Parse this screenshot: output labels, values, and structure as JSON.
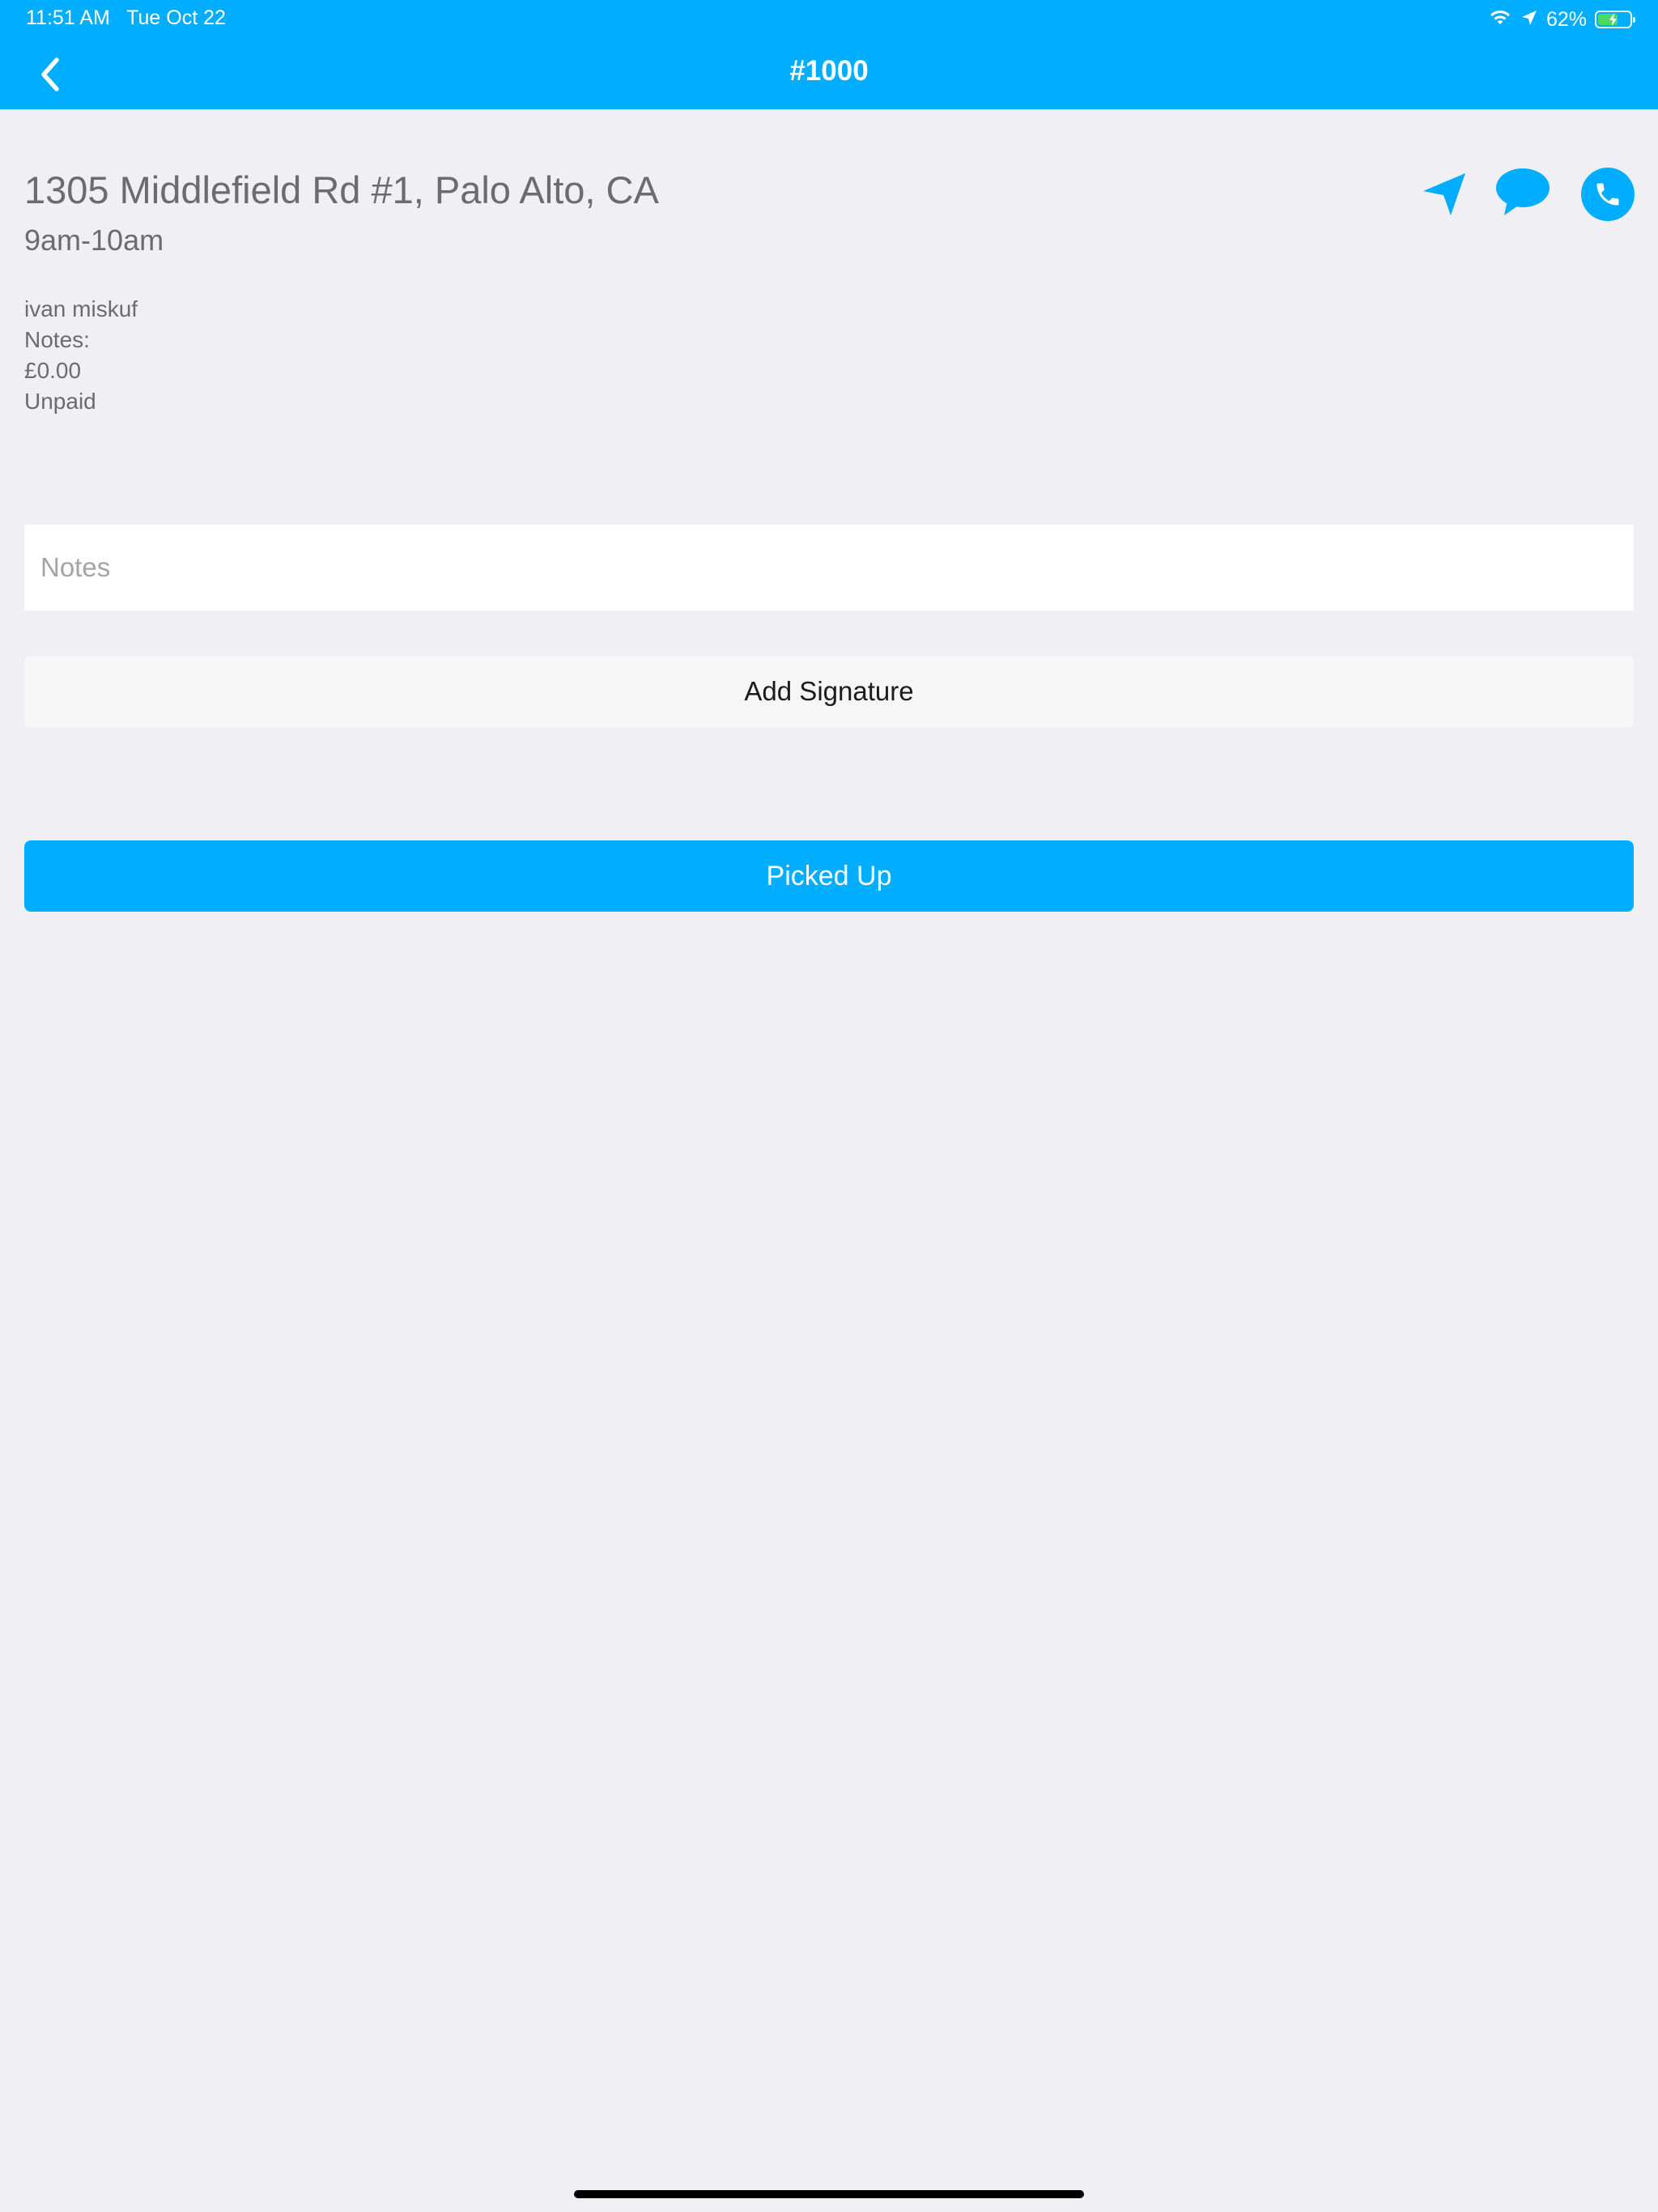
{
  "status_bar": {
    "time_date": "11:51 AM   Tue Oct 22",
    "battery_percent": "62%",
    "battery_level": 0.62,
    "icons": [
      "wifi-icon",
      "location-arrow-icon",
      "battery-icon"
    ]
  },
  "nav": {
    "title": "#1000",
    "back_icon": "chevron-left-icon"
  },
  "order": {
    "address": "1305 Middlefield Rd #1, Palo Alto, CA",
    "time_window": "9am-10am",
    "customer_name": "ivan miskuf",
    "notes_label": "Notes:",
    "amount": "£0.00",
    "payment_status": "Unpaid"
  },
  "actions": {
    "navigate_icon": "navigation-arrow-icon",
    "message_icon": "chat-bubble-icon",
    "call_icon": "phone-icon"
  },
  "form": {
    "notes_placeholder": "Notes",
    "notes_value": "",
    "signature_label": "Add Signature",
    "picked_up_label": "Picked Up"
  },
  "colors": {
    "accent": "#00adfe",
    "background": "#efeff4",
    "text": "#6b6b70"
  }
}
